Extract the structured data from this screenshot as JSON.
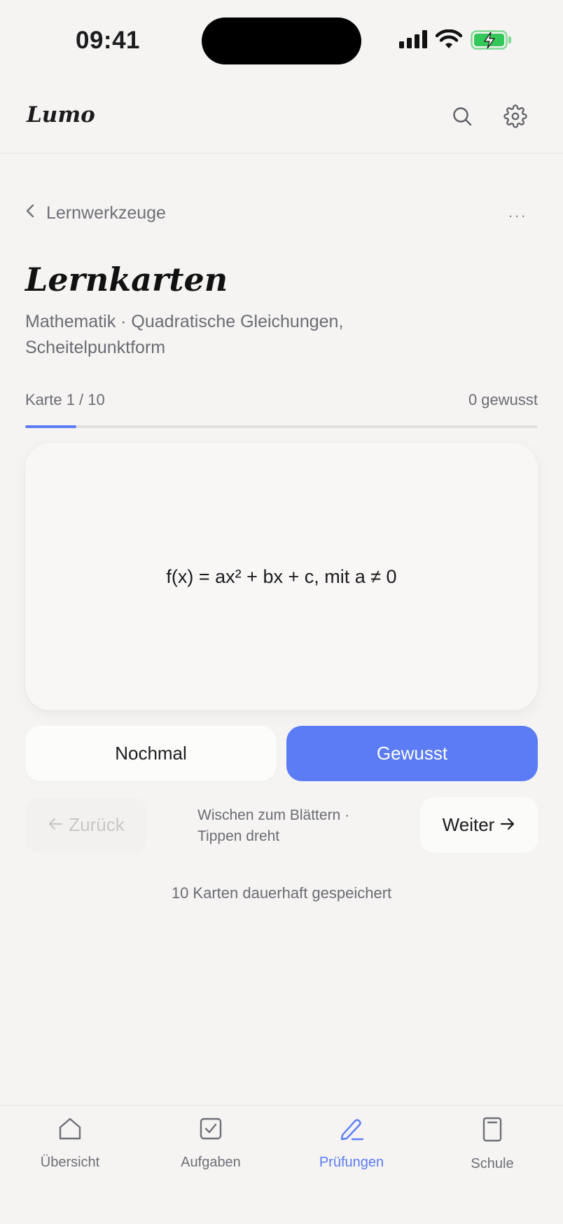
{
  "status_bar": {
    "time": "09:41"
  },
  "header": {
    "logo": "Lumo",
    "icons": [
      "search-icon",
      "gear-icon"
    ]
  },
  "breadcrumb": {
    "back_label": "Lernwerkzeuge",
    "more_label": "..."
  },
  "page": {
    "title": "Lernkarten",
    "subtitle": "Mathematik · Quadratische Gleichungen, Scheitelpunktform"
  },
  "progress": {
    "card_label": "Karte 1 / 10",
    "known_label": "0 gewusst",
    "fraction": 0.1
  },
  "card": {
    "text": "f(x) = ax² + bx + c, mit a ≠ 0"
  },
  "actions": {
    "again_label": "Nochmal",
    "known_label": "Gewusst"
  },
  "navigation": {
    "prev_label": "Zurück",
    "next_label": "Weiter",
    "hint": "Wischen zum Blättern · Tippen dreht"
  },
  "footer_note": "10 Karten dauerhaft gespeichert",
  "tabbar": {
    "items": [
      {
        "label": "Übersicht",
        "icon": "home-icon",
        "active": false
      },
      {
        "label": "Aufgaben",
        "icon": "checkbox-icon",
        "active": false
      },
      {
        "label": "Prüfungen",
        "icon": "pen-icon",
        "active": true
      },
      {
        "label": "Schule",
        "icon": "book-icon",
        "active": false
      }
    ]
  },
  "colors": {
    "accent": "#5b7cf5",
    "background": "#f5f4f2",
    "battery": "#34c759"
  }
}
